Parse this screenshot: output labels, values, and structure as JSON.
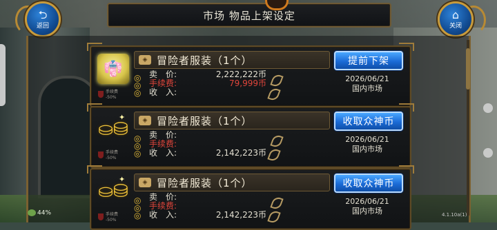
{
  "title": "市场  物品上架设定",
  "back_button": {
    "label": "返回"
  },
  "close_button": {
    "label": "关闭"
  },
  "listings": [
    {
      "name": "冒险者服装（1个）",
      "action": "提前下架",
      "icon": "clothes-icon",
      "price_label": "卖　价:",
      "price": "2,222,222币",
      "fee_label": "手续费:",
      "fee": "79,999币",
      "income_label": "收　入:",
      "income": "",
      "date": "2026/06/21",
      "market": "国内市场",
      "fee_badge_1": "手续费",
      "fee_badge_2": "-50%"
    },
    {
      "name": "冒险者服装（1个）",
      "action": "收取众神币",
      "icon": "coins-icon",
      "price_label": "卖　价:",
      "price": "",
      "fee_label": "手续费:",
      "fee": "",
      "income_label": "收　入:",
      "income": "2,142,223币",
      "date": "2026/06/21",
      "market": "国内市场",
      "fee_badge_1": "手续费",
      "fee_badge_2": "-50%"
    },
    {
      "name": "冒险者服装（1个）",
      "action": "收取众神币",
      "icon": "coins-icon",
      "price_label": "卖　价:",
      "price": "",
      "fee_label": "手续费:",
      "fee": "",
      "income_label": "收　入:",
      "income": "2,142,223币",
      "date": "2026/06/21",
      "market": "国内市场",
      "fee_badge_1": "手续费",
      "fee_badge_2": "-50%"
    }
  ],
  "hud": {
    "battery": "44%",
    "version": "4.1.10a(1)"
  },
  "colors": {
    "accent_blue": "#1b6bd6",
    "fee_red": "#e0453b",
    "gold_frame": "#7b6030"
  }
}
